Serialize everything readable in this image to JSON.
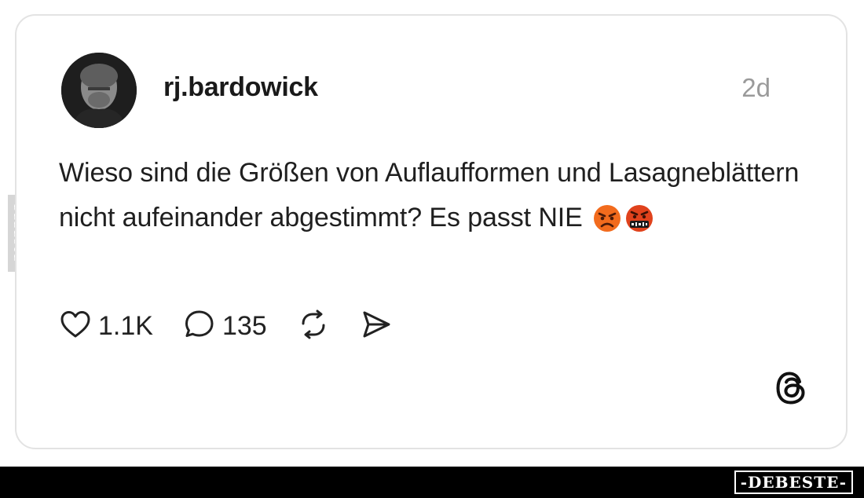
{
  "post": {
    "username": "rj.bardowick",
    "time": "2d",
    "text": "Wieso sind die Größen von Auflaufformen und Lasagneblättern nicht aufeinander abgestimmt? Es passt NIE",
    "emojis": [
      "pouting-face",
      "face-with-symbols-on-mouth"
    ],
    "avatar_alt": "profile photo"
  },
  "actions": {
    "like_count": "1.1K",
    "reply_count": "135",
    "repost_icon": "repost-icon",
    "share_icon": "send-icon"
  },
  "app_logo": "threads-logo",
  "watermark": {
    "side": "DEBESTE",
    "brand": "-DEBESTE-"
  }
}
